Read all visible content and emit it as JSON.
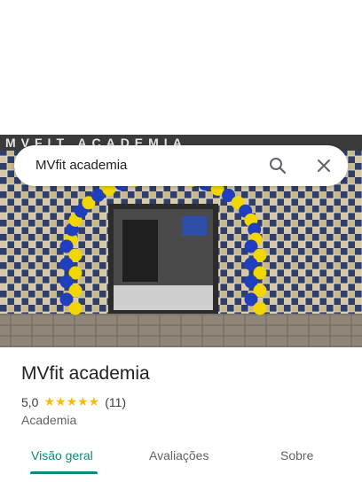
{
  "search": {
    "query": "MVfit academia"
  },
  "place": {
    "name": "MVfit academia",
    "rating": "5,0",
    "stars": "★★★★★",
    "reviews": "(11)",
    "category": "Academia",
    "storefront_sign": "MVFIT ACADEMIA"
  },
  "tabs": [
    {
      "label": "Visão geral"
    },
    {
      "label": "Avaliações"
    },
    {
      "label": "Sobre"
    }
  ],
  "colors": {
    "accent": "#0b8a82",
    "star": "#fbbc04",
    "balloon_blue": "#1f3fbf",
    "balloon_yellow": "#f2d600"
  }
}
